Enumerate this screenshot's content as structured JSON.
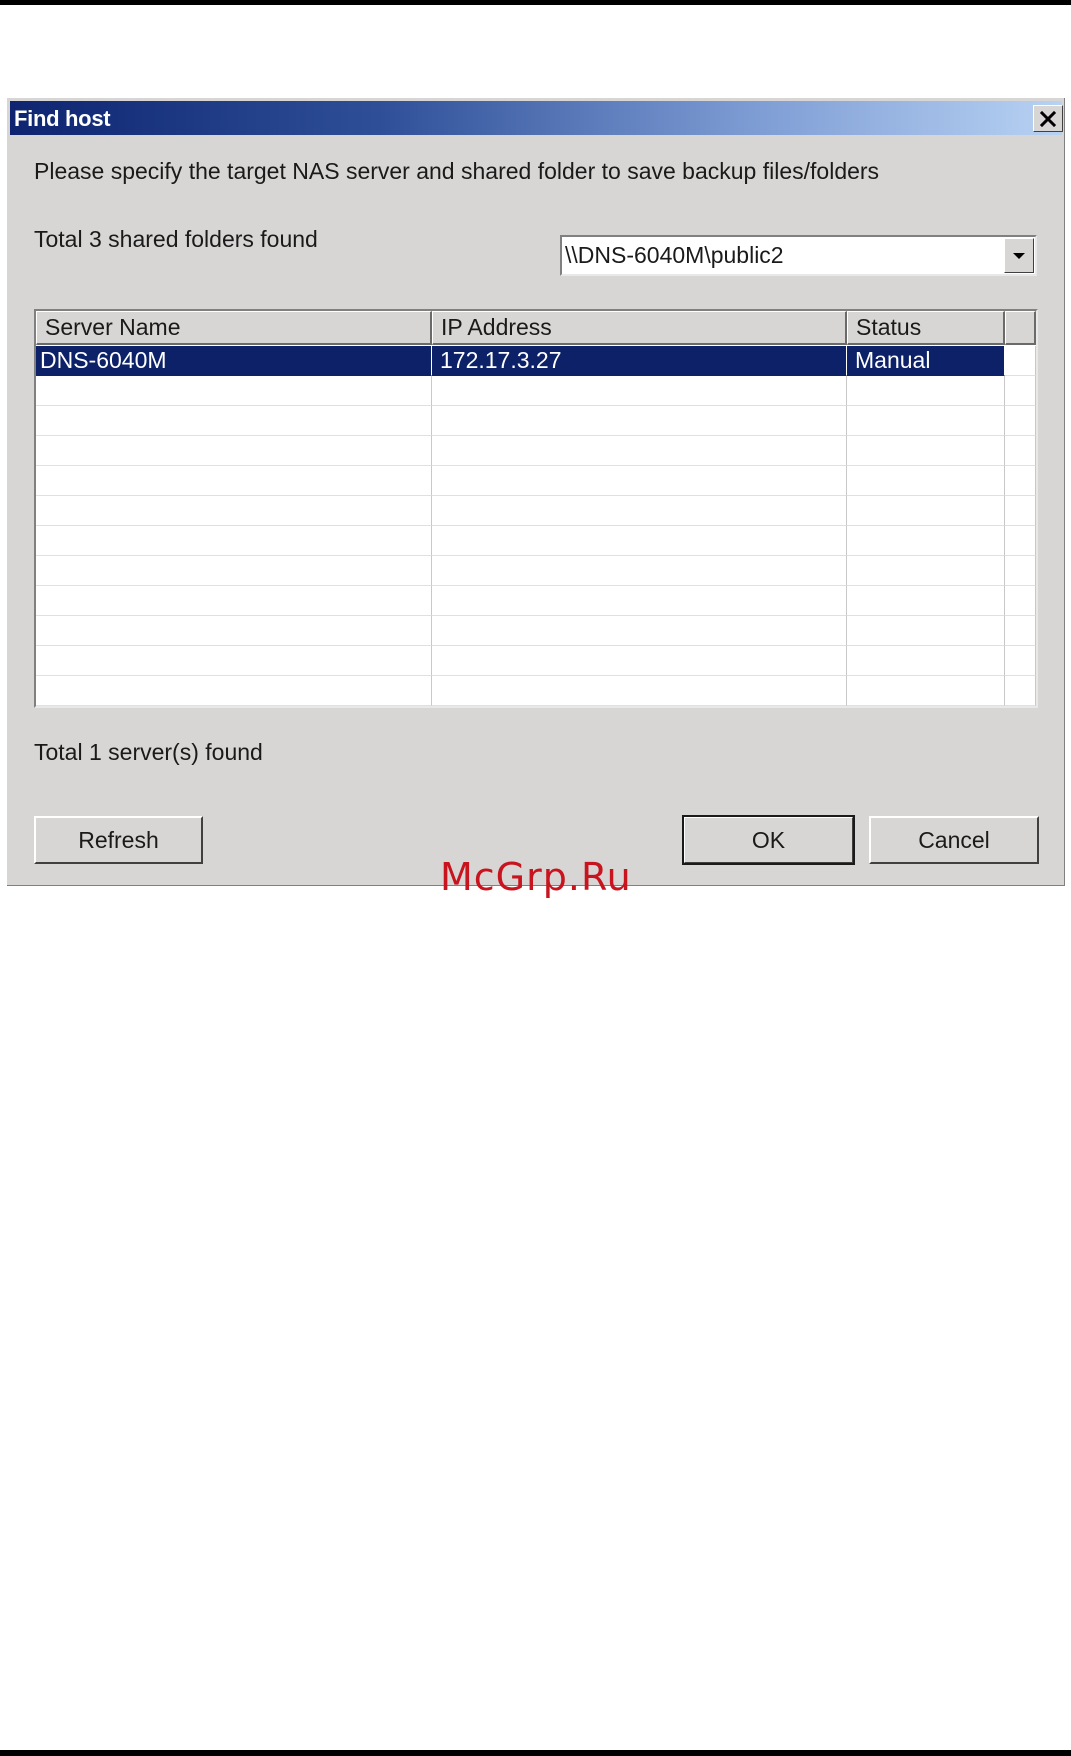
{
  "dialog": {
    "title": "Find host",
    "instructions": "Please specify the target NAS server and shared folder to save backup files/folders",
    "folders_found": "Total 3 shared folders found",
    "shared_folder_select": {
      "selected_value": "\\\\DNS-6040M\\public2"
    },
    "server_list": {
      "columns": [
        "Server Name",
        "IP Address",
        "Status"
      ],
      "rows": [
        {
          "server_name": "DNS-6040M",
          "ip_address": "172.17.3.27",
          "status": "Manual",
          "selected": true
        }
      ],
      "empty_rows": 11
    },
    "servers_found": "Total 1 server(s) found",
    "buttons": {
      "refresh": "Refresh",
      "ok": "OK",
      "cancel": "Cancel"
    }
  },
  "watermark": "McGrp.Ru",
  "colors": {
    "titlebar_start": "#0e2470",
    "titlebar_end": "#b8d2f3",
    "selection": "#0c2168",
    "dialog_bg": "#d8d6d4",
    "watermark": "#c8141e"
  },
  "icons": {
    "close": "close-icon",
    "dropdown": "chevron-down-icon"
  }
}
